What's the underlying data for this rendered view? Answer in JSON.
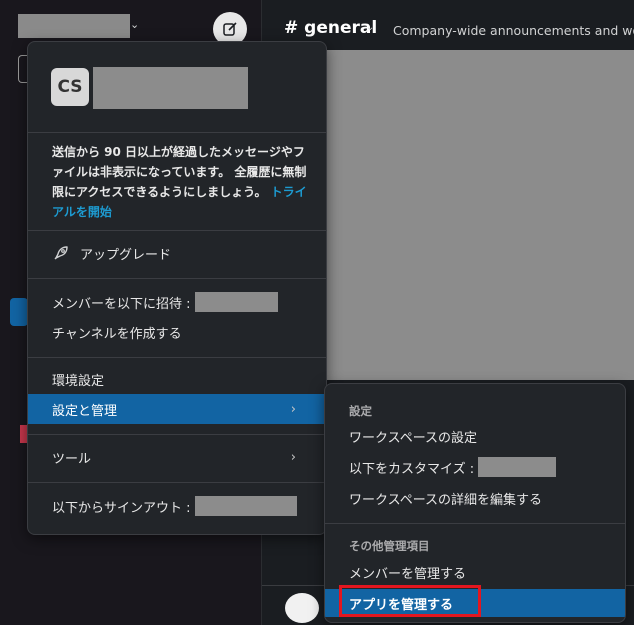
{
  "channel": {
    "name": "# general",
    "topic": "Company-wide announcements and work-"
  },
  "menu": {
    "avatar_initials": "CS",
    "notice_text": "送信から 90 日以上が経過したメッセージやファイルは非表示になっています。 全履歴に無制限にアクセスできるようにしましょう。",
    "notice_link": "トライアルを開始",
    "upgrade_label": "アップグレード",
    "invite_label": "メンバーを以下に招待 :",
    "create_channel_label": "チャンネルを作成する",
    "preferences_label": "環境設定",
    "settings_admin_label": "設定と管理",
    "tools_label": "ツール",
    "signout_label": "以下からサインアウト :",
    "chevron": "›"
  },
  "submenu": {
    "section_settings": "設定",
    "workspace_settings": "ワークスペースの設定",
    "customize_label": "以下をカスタマイズ :",
    "edit_workspace_details": "ワークスペースの詳細を編集する",
    "section_other_admin": "その他管理項目",
    "manage_members": "メンバーを管理する",
    "manage_apps": "アプリを管理する"
  },
  "colors": {
    "accent": "#1264a3",
    "link": "#1d9bd1",
    "highlight": "#e3161f",
    "menu_bg": "#222529"
  }
}
